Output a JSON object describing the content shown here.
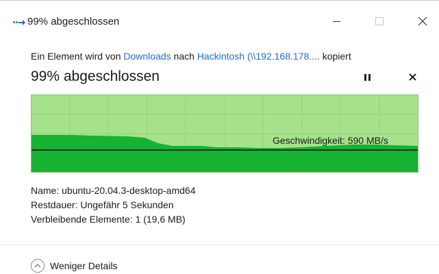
{
  "window": {
    "title": "99% abgeschlossen"
  },
  "description": {
    "prefix": "Ein Element wird von ",
    "source": "Downloads",
    "middle": " nach ",
    "destination": "Hackintosh (\\\\192.168.178....",
    "suffix": " kopiert"
  },
  "progress": {
    "heading": "99% abgeschlossen",
    "percent": 99,
    "speed_label": "Geschwindigkeit: 590 MB/s"
  },
  "details": {
    "name_label": "Name:",
    "name_value": "ubuntu-20.04.3-desktop-amd64",
    "remaining_label": "Restdauer:",
    "remaining_value": "Ungefähr 5 Sekunden",
    "items_label": "Verbleibende Elemente:",
    "items_value": "1 (19,6 MB)"
  },
  "footer": {
    "toggle_label": "Weniger Details"
  },
  "colors": {
    "graph_light": "#a6e28c",
    "graph_dark": "#16b232",
    "grid": "#8fd47a",
    "link": "#1e6cd0"
  },
  "icons": {
    "title": "copy-arrow-icon",
    "pause": "pause-icon",
    "cancel": "close-icon",
    "toggle": "chevron-up-icon"
  }
}
